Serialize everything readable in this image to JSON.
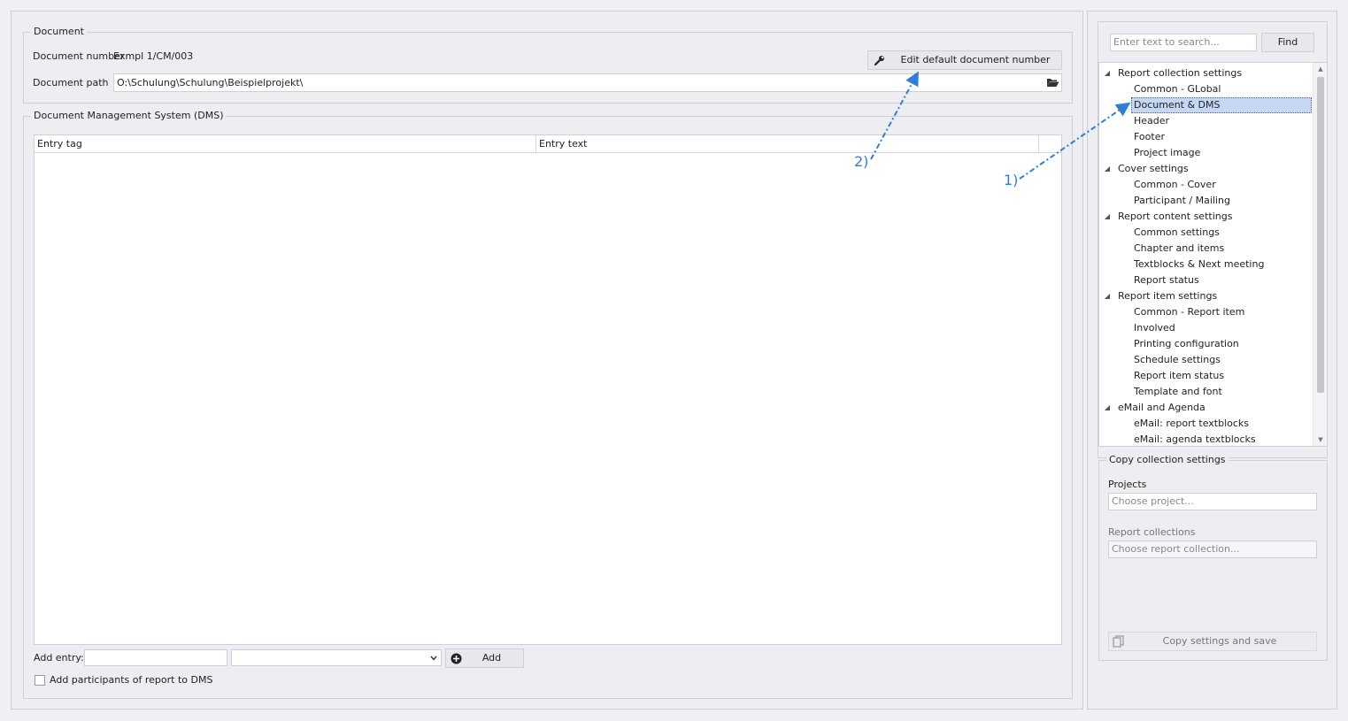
{
  "document": {
    "group_title": "Document",
    "number_label": "Document number",
    "number_value": "Exmpl 1/CM/003",
    "edit_button": "Edit default document number",
    "path_label": "Document path",
    "path_value": "O:\\Schulung\\Schulung\\Beispielprojekt\\"
  },
  "dms": {
    "group_title": "Document Management System (DMS)",
    "columns": [
      "Entry tag",
      "Entry text"
    ],
    "add_entry_label": "Add entry:",
    "add_entry_value": "",
    "add_entry_select": "",
    "add_button": "Add",
    "participants_checkbox": "Add participants of report to DMS",
    "participants_checked": false
  },
  "search": {
    "placeholder": "Enter text to search...",
    "find_button": "Find"
  },
  "tree": {
    "groups": [
      {
        "label": "Report collection settings",
        "items": [
          "Common - GLobal",
          "Document & DMS",
          "Header",
          "Footer",
          "Project image"
        ]
      },
      {
        "label": "Cover settings",
        "items": [
          "Common - Cover",
          "Participant / Mailing"
        ]
      },
      {
        "label": "Report content settings",
        "items": [
          "Common settings",
          "Chapter and items",
          "Textblocks & Next meeting",
          "Report status"
        ]
      },
      {
        "label": "Report item settings",
        "items": [
          "Common - Report item",
          "Involved",
          "Printing configuration",
          "Schedule settings",
          "Report item status",
          "Template and font"
        ]
      },
      {
        "label": "eMail and Agenda",
        "items": [
          "eMail: report textblocks",
          "eMail: agenda textblocks"
        ]
      }
    ],
    "selected": "Document & DMS"
  },
  "copy": {
    "group_title": "Copy collection settings",
    "projects_label": "Projects",
    "projects_placeholder": "Choose project...",
    "collections_label": "Report collections",
    "collections_placeholder": "Choose report collection...",
    "copy_button": "Copy settings and save"
  },
  "annotations": {
    "one": "1)",
    "two": "2)"
  },
  "colors": {
    "annotation": "#2f7fd9",
    "selection": "#c5d7f2"
  }
}
